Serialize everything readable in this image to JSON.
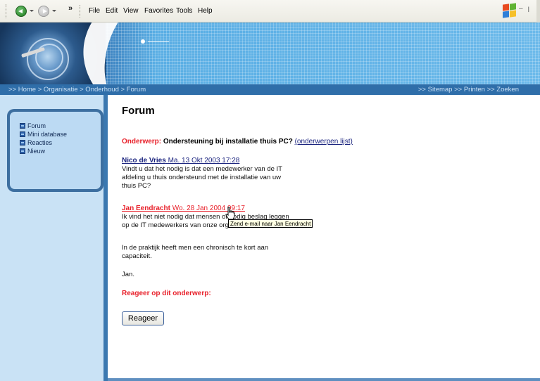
{
  "browser": {
    "menu": [
      "File",
      "Edit",
      "View",
      "Favorites",
      "Tools",
      "Help"
    ],
    "chevron": "»",
    "window_buttons": "– ꞁ"
  },
  "navbar": {
    "breadcrumb": ">> Home > Organisatie > Onderhoud > Forum",
    "right_links": ">> Sitemap >> Printen >> Zoeken"
  },
  "sidebar": {
    "items": [
      {
        "label": "Forum",
        "icon": "page-icon"
      },
      {
        "label": "Mini database",
        "icon": "page-icon"
      },
      {
        "label": "Reacties",
        "icon": "page-icon"
      },
      {
        "label": "Nieuw",
        "icon": "page-icon"
      }
    ]
  },
  "main": {
    "title": "Forum",
    "subject_label": "Onderwerp:",
    "subject_text": "Ondersteuning bij installatie thuis PC?",
    "subject_link": "(onderwerpen lijst)",
    "posts": [
      {
        "author": "Nico de Vries",
        "date": "Ma. 13 Okt 2003 17:28",
        "body": "Vindt u dat het nodig is dat een medewerker van de IT afdeling u thuis ondersteund met de installatie van uw thuis PC?"
      },
      {
        "author": "Jan Eendracht",
        "date": "Wo. 28 Jan 2004 09:17",
        "body": "Ik vind het niet nodig dat mensen onnodig beslag leggen op de IT medewerkers van onze organisatie.",
        "body2": "In de praktijk heeft men een chronisch te kort aan capaciteit.",
        "body3": "Jan."
      }
    ],
    "tooltip": "Zend e-mail naar Jan Eendracht",
    "reply_title": "Reageer op dit onderwerp:",
    "reply_button": "Reageer"
  },
  "colors": {
    "accent_red": "#e8202a",
    "link_blue": "#1a237e",
    "nav_blue": "#2f6ea9",
    "sidebar_bg": "#c9e2f5"
  }
}
